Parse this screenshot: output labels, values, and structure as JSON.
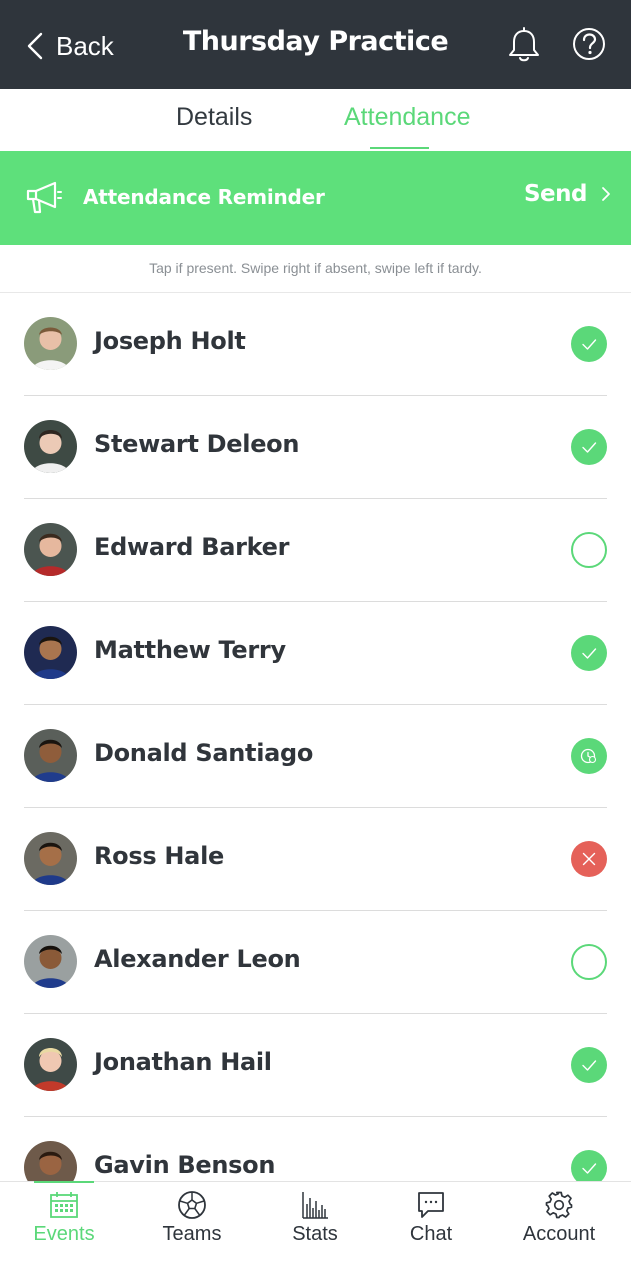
{
  "header": {
    "back_label": "Back",
    "title": "Thursday Practice"
  },
  "tabs": [
    {
      "label": "Details",
      "active": false
    },
    {
      "label": "Attendance",
      "active": true
    }
  ],
  "banner": {
    "label": "Attendance Reminder",
    "action_label": "Send"
  },
  "hint": "Tap if present. Swipe right if absent, swipe left if tardy.",
  "roster": [
    {
      "name": "Joseph Holt",
      "status": "present"
    },
    {
      "name": "Stewart Deleon",
      "status": "present"
    },
    {
      "name": "Edward Barker",
      "status": "not-marked"
    },
    {
      "name": "Matthew Terry",
      "status": "present"
    },
    {
      "name": "Donald Santiago",
      "status": "tardy"
    },
    {
      "name": "Ross Hale",
      "status": "absent"
    },
    {
      "name": "Alexander Leon",
      "status": "not-marked"
    },
    {
      "name": "Jonathan Hail",
      "status": "present"
    },
    {
      "name": "Gavin Benson",
      "status": "present"
    }
  ],
  "tabbar": [
    {
      "label": "Events",
      "icon": "calendar-icon",
      "active": true
    },
    {
      "label": "Teams",
      "icon": "soccer-ball-icon",
      "active": false
    },
    {
      "label": "Stats",
      "icon": "bar-chart-icon",
      "active": false
    },
    {
      "label": "Chat",
      "icon": "chat-bubble-icon",
      "active": false
    },
    {
      "label": "Account",
      "icon": "gear-icon",
      "active": false
    }
  ],
  "colors": {
    "header_bg": "#2f353c",
    "accent_green": "#5bd879",
    "banner_green": "#5ee07b",
    "absent_red": "#e56159"
  }
}
